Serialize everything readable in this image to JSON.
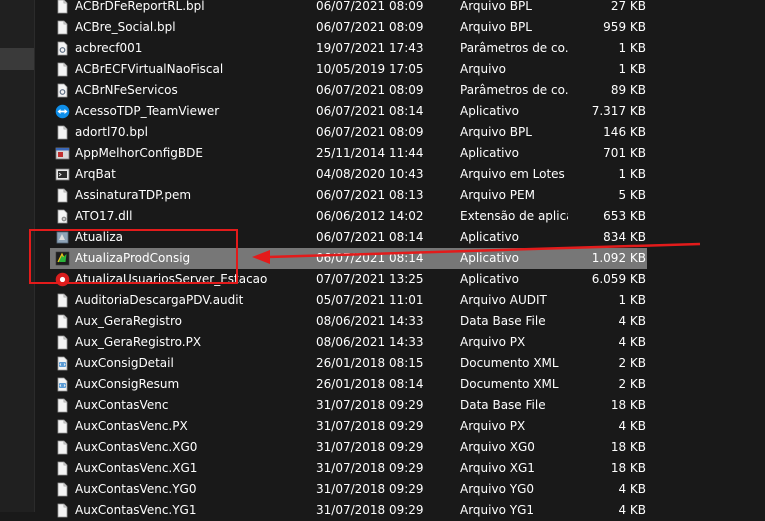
{
  "colors": {
    "background": "#191919",
    "text": "#ffffff",
    "selected_row": "#777777",
    "annotation": "#e31b1b",
    "teamviewer_blue": "#0e8ee9"
  },
  "files": [
    {
      "name": "ACBrDFeReportRL.bpl",
      "date": "06/07/2021 08:09",
      "type": "Arquivo BPL",
      "size": "27 KB",
      "icon": "file-icon"
    },
    {
      "name": "ACBre_Social.bpl",
      "date": "06/07/2021 08:09",
      "type": "Arquivo BPL",
      "size": "959 KB",
      "icon": "file-icon"
    },
    {
      "name": "acbrecf001",
      "date": "19/07/2021 17:43",
      "type": "Parâmetros de co...",
      "size": "1 KB",
      "icon": "settings-file-icon"
    },
    {
      "name": "ACBrECFVirtualNaoFiscal",
      "date": "10/05/2019 17:05",
      "type": "Arquivo",
      "size": "1 KB",
      "icon": "file-icon"
    },
    {
      "name": "ACBrNFeServicos",
      "date": "06/07/2021 08:09",
      "type": "Parâmetros de co...",
      "size": "89 KB",
      "icon": "settings-file-icon"
    },
    {
      "name": "AcessoTDP_TeamViewer",
      "date": "06/07/2021 08:14",
      "type": "Aplicativo",
      "size": "7.317 KB",
      "icon": "teamviewer-icon"
    },
    {
      "name": "adortl70.bpl",
      "date": "06/07/2021 08:09",
      "type": "Arquivo BPL",
      "size": "146 KB",
      "icon": "file-icon"
    },
    {
      "name": "AppMelhorConfigBDE",
      "date": "25/11/2014 11:44",
      "type": "Aplicativo",
      "size": "701 KB",
      "icon": "app-icon"
    },
    {
      "name": "ArqBat",
      "date": "04/08/2020 10:43",
      "type": "Arquivo em Lotes ...",
      "size": "1 KB",
      "icon": "batch-file-icon"
    },
    {
      "name": "AssinaturaTDP.pem",
      "date": "06/07/2021 08:13",
      "type": "Arquivo PEM",
      "size": "5 KB",
      "icon": "file-icon"
    },
    {
      "name": "ATO17.dll",
      "date": "06/06/2012 14:02",
      "type": "Extensão de aplica...",
      "size": "653 KB",
      "icon": "dll-icon"
    },
    {
      "name": "Atualiza",
      "date": "06/07/2021 08:14",
      "type": "Aplicativo",
      "size": "834 KB",
      "icon": "updater-icon"
    },
    {
      "name": "AtualizaProdConsig",
      "date": "06/07/2021 08:14",
      "type": "Aplicativo",
      "size": "1.092 KB",
      "icon": "updater-green-icon",
      "selected": true
    },
    {
      "name": "AtualizaUsuariosServer_Estacao",
      "date": "07/07/2021 13:25",
      "type": "Aplicativo",
      "size": "6.059 KB",
      "icon": "red-app-icon"
    },
    {
      "name": "AuditoriaDescargaPDV.audit",
      "date": "05/07/2021 11:01",
      "type": "Arquivo AUDIT",
      "size": "1 KB",
      "icon": "file-icon"
    },
    {
      "name": "Aux_GeraRegistro",
      "date": "08/06/2021 14:33",
      "type": "Data Base File",
      "size": "4 KB",
      "icon": "file-icon"
    },
    {
      "name": "Aux_GeraRegistro.PX",
      "date": "08/06/2021 14:33",
      "type": "Arquivo PX",
      "size": "4 KB",
      "icon": "file-icon"
    },
    {
      "name": "AuxConsigDetail",
      "date": "26/01/2018 08:15",
      "type": "Documento XML",
      "size": "2 KB",
      "icon": "xml-icon"
    },
    {
      "name": "AuxConsigResum",
      "date": "26/01/2018 08:14",
      "type": "Documento XML",
      "size": "2 KB",
      "icon": "xml-icon"
    },
    {
      "name": "AuxContasVenc",
      "date": "31/07/2018 09:29",
      "type": "Data Base File",
      "size": "18 KB",
      "icon": "file-icon"
    },
    {
      "name": "AuxContasVenc.PX",
      "date": "31/07/2018 09:29",
      "type": "Arquivo PX",
      "size": "4 KB",
      "icon": "file-icon"
    },
    {
      "name": "AuxContasVenc.XG0",
      "date": "31/07/2018 09:29",
      "type": "Arquivo XG0",
      "size": "18 KB",
      "icon": "file-icon"
    },
    {
      "name": "AuxContasVenc.XG1",
      "date": "31/07/2018 09:29",
      "type": "Arquivo XG1",
      "size": "18 KB",
      "icon": "file-icon"
    },
    {
      "name": "AuxContasVenc.YG0",
      "date": "31/07/2018 09:29",
      "type": "Arquivo YG0",
      "size": "4 KB",
      "icon": "file-icon"
    },
    {
      "name": "AuxContasVenc.YG1",
      "date": "31/07/2018 09:29",
      "type": "Arquivo YG1",
      "size": "4 KB",
      "icon": "file-icon"
    }
  ]
}
